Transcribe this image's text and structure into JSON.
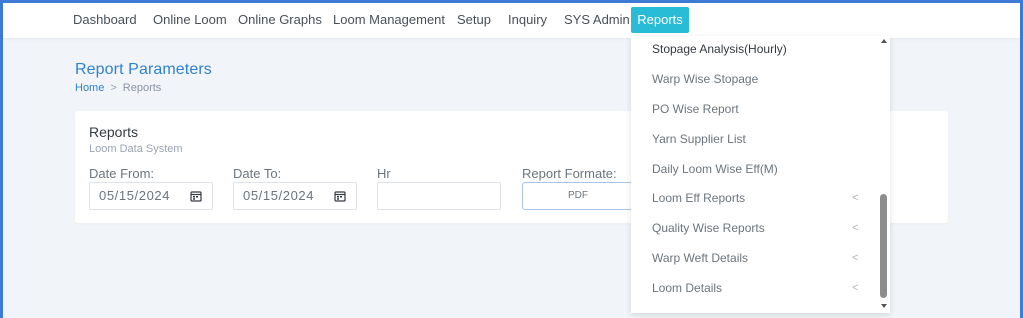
{
  "nav": {
    "items": [
      {
        "label": "Dashboard",
        "active": false
      },
      {
        "label": "Online Loom",
        "active": false
      },
      {
        "label": "Online Graphs",
        "active": false
      },
      {
        "label": "Loom Management",
        "active": false
      },
      {
        "label": "Setup",
        "active": false
      },
      {
        "label": "Inquiry",
        "active": false
      },
      {
        "label": "SYS Admin",
        "active": false
      },
      {
        "label": "Reports",
        "active": true
      }
    ]
  },
  "page": {
    "title": "Report Parameters",
    "breadcrumb": {
      "home": "Home",
      "separator": ">",
      "current": "Reports"
    }
  },
  "card": {
    "title": "Reports",
    "subtitle": "Loom Data System",
    "fields": {
      "date_from": {
        "label": "Date From:",
        "value": "05/15/2024",
        "icon": "calendar-icon"
      },
      "date_to": {
        "label": "Date To:",
        "value": "05/15/2024",
        "icon": "calendar-icon"
      },
      "hr": {
        "label": "Hr",
        "value": ""
      },
      "report_format": {
        "label": "Report Formate:",
        "value": "PDF"
      }
    }
  },
  "dropdown": {
    "items": [
      {
        "label": "Stopage Analysis(Hourly)",
        "submenu": false
      },
      {
        "label": "Warp Wise Stopage",
        "submenu": false
      },
      {
        "label": "PO Wise Report",
        "submenu": false
      },
      {
        "label": "Yarn Supplier List",
        "submenu": false
      },
      {
        "label": "Daily Loom Wise Eff(M)",
        "submenu": false
      },
      {
        "label": "Loom Eff Reports",
        "submenu": true
      },
      {
        "label": "Quality Wise Reports",
        "submenu": true
      },
      {
        "label": "Warp Weft Details",
        "submenu": true
      },
      {
        "label": "Loom Details",
        "submenu": true
      }
    ],
    "submenu_chevron": "<"
  },
  "colors": {
    "accent": "#29bcd6",
    "title_blue": "#3182ce",
    "frame_blue": "#3d7bd6",
    "background": "#f1f4f9"
  }
}
